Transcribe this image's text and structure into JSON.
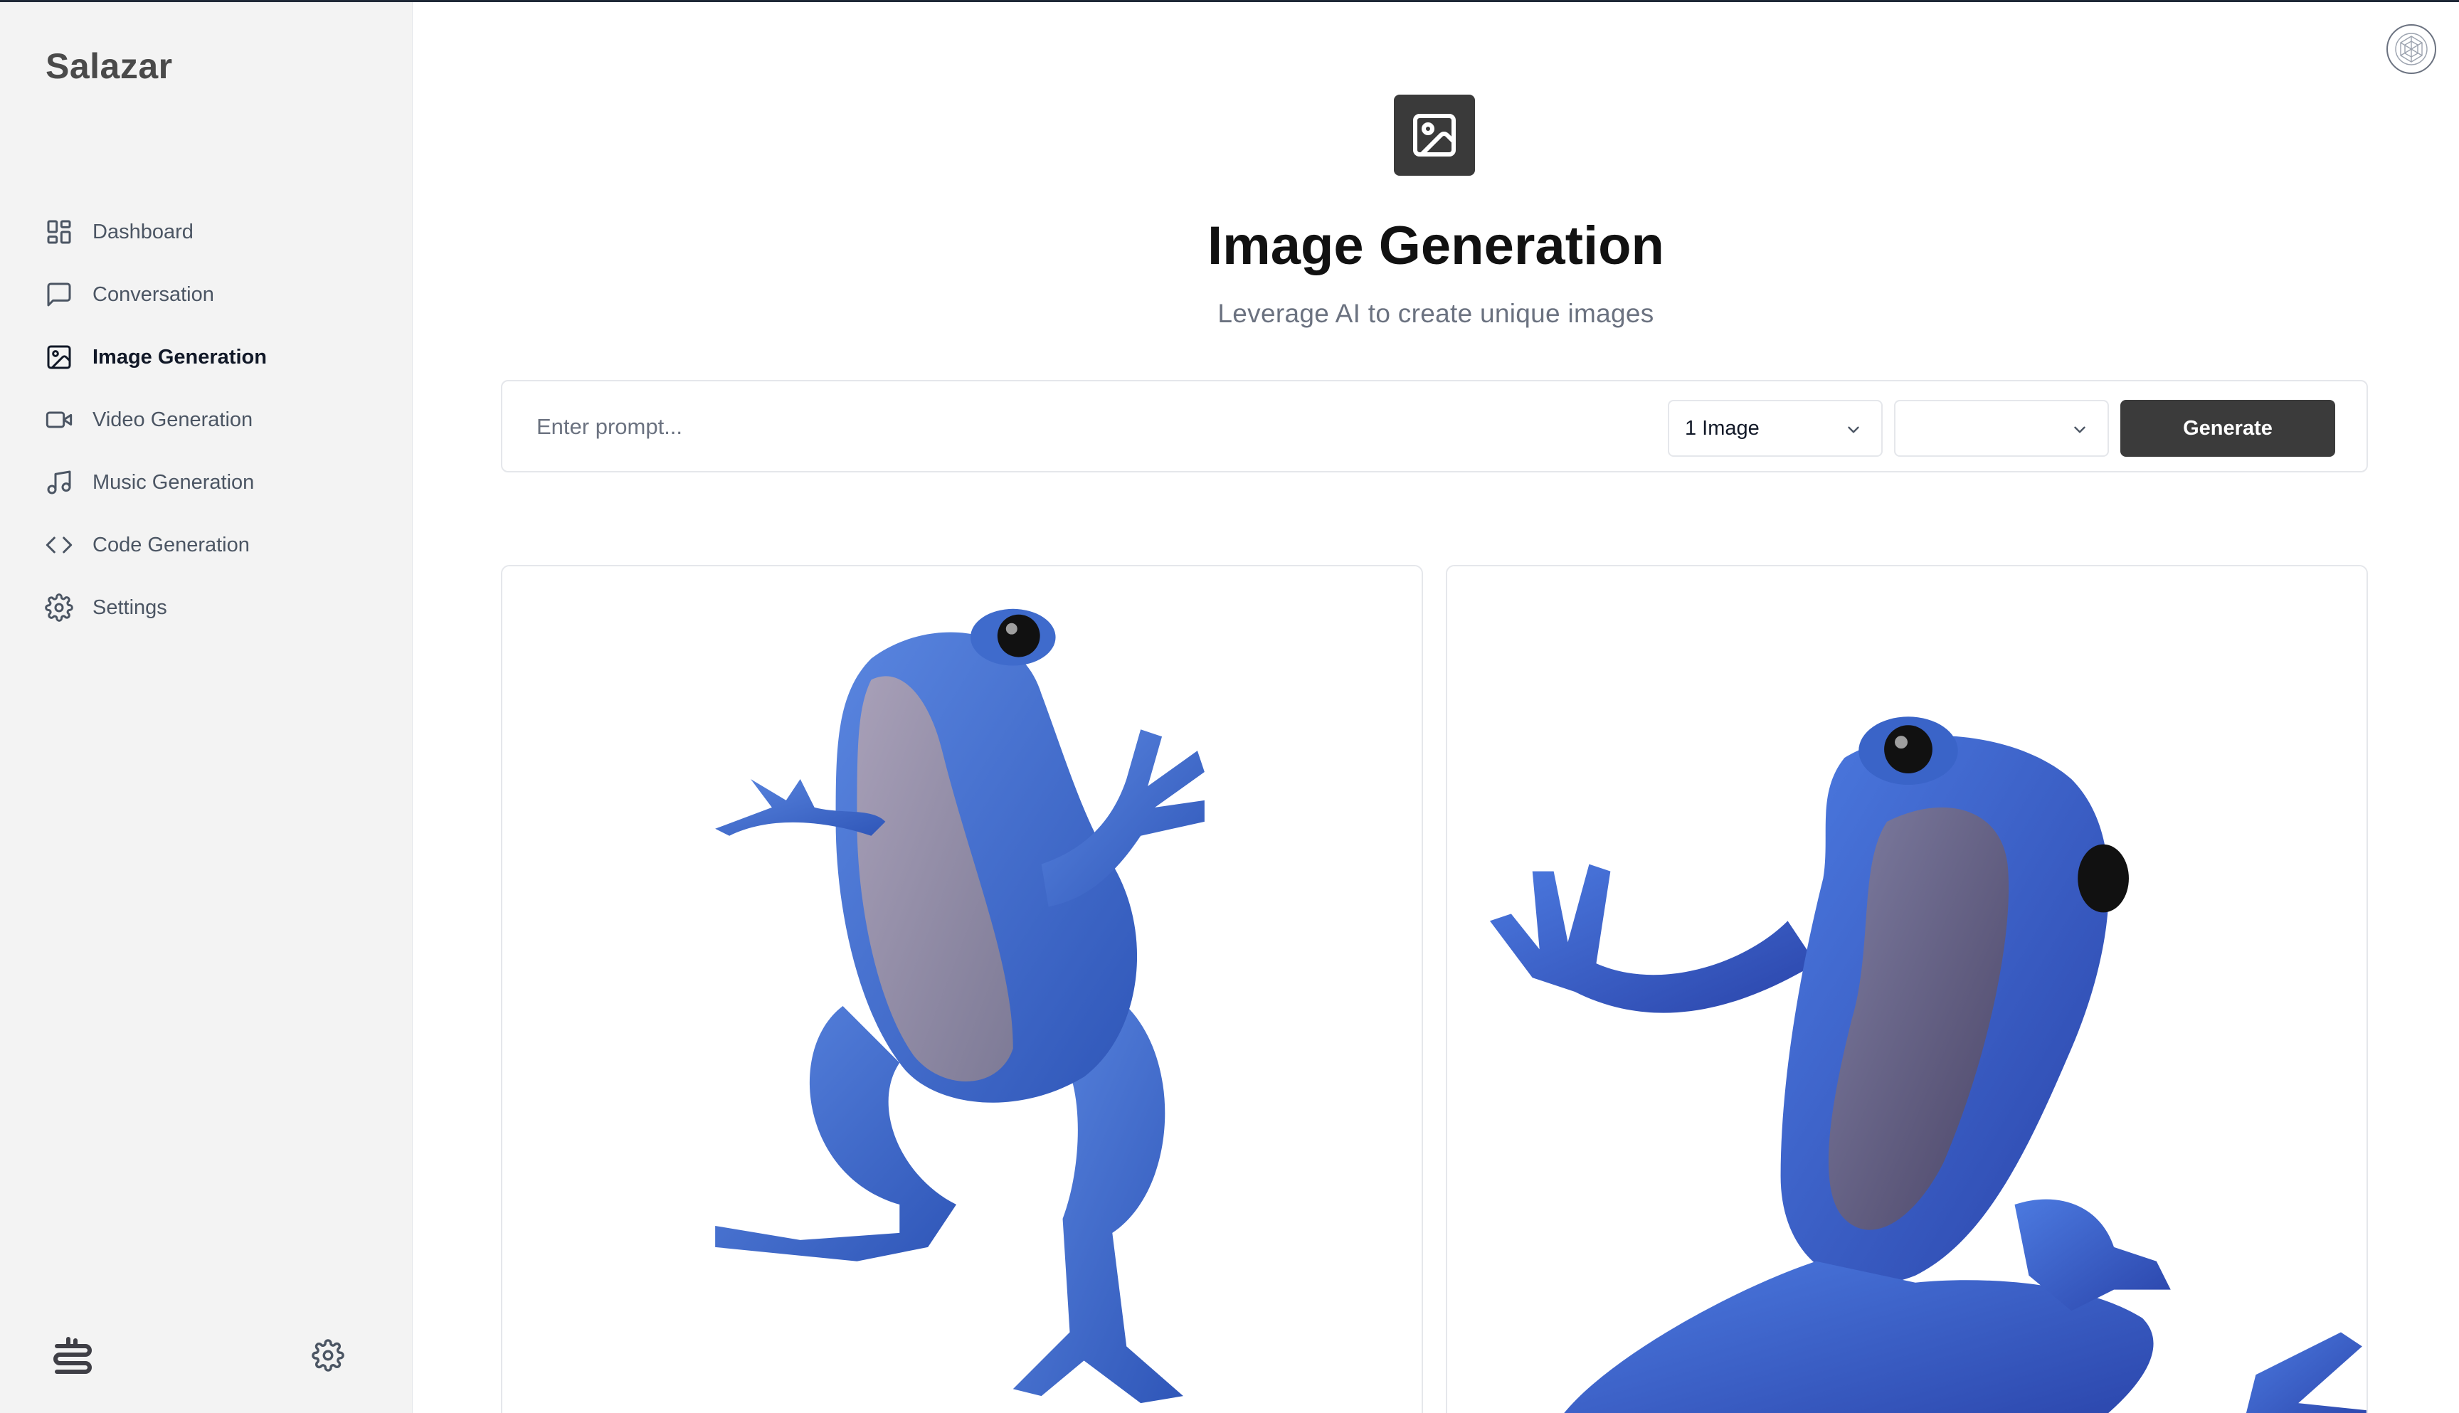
{
  "app": {
    "brand": "Salazar"
  },
  "sidebar": {
    "items": [
      {
        "label": "Dashboard",
        "icon": "dashboard-icon",
        "active": false
      },
      {
        "label": "Conversation",
        "icon": "message-square-icon",
        "active": false
      },
      {
        "label": "Image Generation",
        "icon": "image-icon",
        "active": true
      },
      {
        "label": "Video Generation",
        "icon": "video-icon",
        "active": false
      },
      {
        "label": "Music Generation",
        "icon": "music-icon",
        "active": false
      },
      {
        "label": "Code Generation",
        "icon": "code-icon",
        "active": false
      },
      {
        "label": "Settings",
        "icon": "settings-icon",
        "active": false
      }
    ]
  },
  "header": {
    "title": "Image Generation",
    "subtitle": "Leverage AI to create unique images",
    "icon": "image-icon"
  },
  "form": {
    "prompt_placeholder": "Enter prompt...",
    "prompt_value": "",
    "amount_value": "1 Image",
    "resolution_value": "",
    "generate_label": "Generate"
  },
  "results": [
    {
      "subject": "blue-frog-image-1"
    },
    {
      "subject": "blue-frog-image-2"
    }
  ],
  "colors": {
    "sidebar_bg": "#f3f3f3",
    "primary_button": "#3b3b3b",
    "frog_blue": "#3a6fd0"
  }
}
